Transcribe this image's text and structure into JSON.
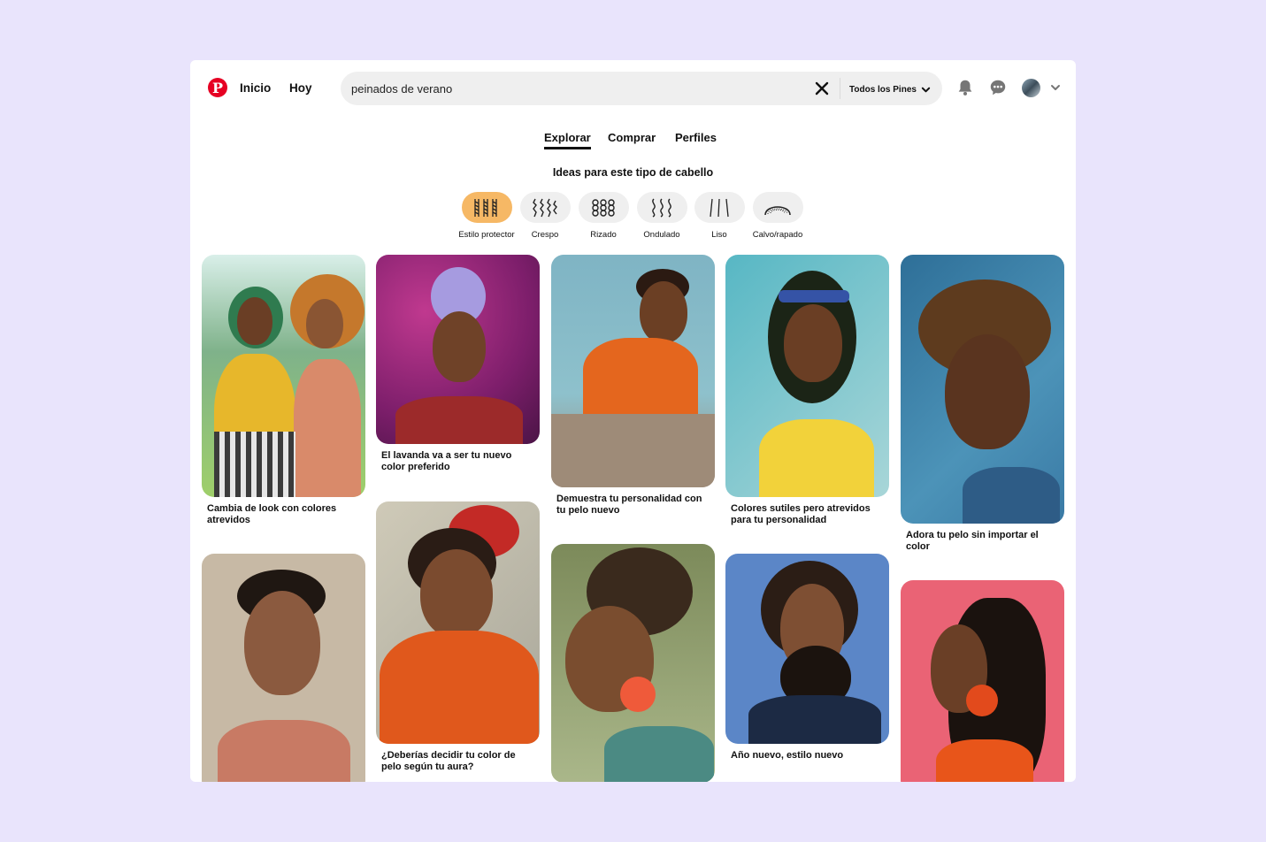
{
  "header": {
    "nav": {
      "home": "Inicio",
      "today": "Hoy"
    },
    "search": {
      "value": "peinados de verano",
      "scope": "Todos los Pines"
    }
  },
  "tabs": [
    "Explorar",
    "Comprar",
    "Perfiles"
  ],
  "ideas": {
    "title": "Ideas para este tipo de cabello",
    "types": [
      "Estilo protector",
      "Crespo",
      "Rizado",
      "Ondulado",
      "Liso",
      "Calvo/rapado"
    ]
  },
  "pins": [
    "Cambia de look con colores atrevidos",
    "El lavanda va a ser tu nuevo color preferido",
    "Demuestra tu personalidad con tu pelo nuevo",
    "Colores sutiles pero atrevidos para tu personalidad",
    "Adora tu pelo sin importar el color",
    "",
    "¿Deberías decidir tu color de pelo según tu aura?",
    "",
    "Año nuevo, estilo nuevo",
    ""
  ],
  "colors": {
    "brand": "#e60023",
    "active_hair_type": "#f6b865",
    "background": "#e9e4fc"
  }
}
